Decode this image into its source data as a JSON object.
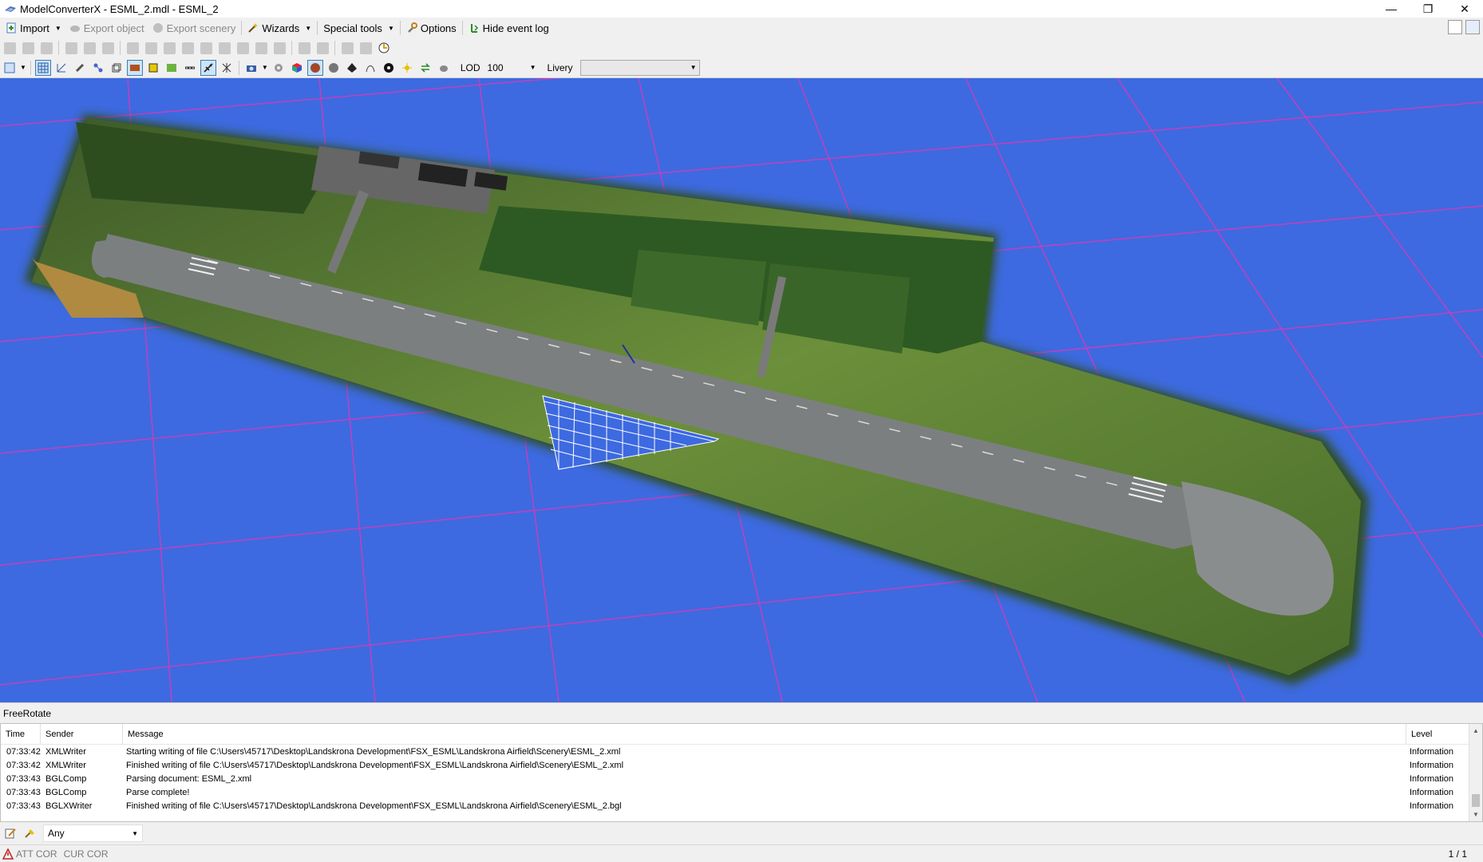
{
  "window": {
    "title": "ModelConverterX - ESML_2.mdl - ESML_2",
    "minimize": "—",
    "restore": "❐",
    "close": "✕"
  },
  "menu": {
    "import": "Import",
    "export_object": "Export object",
    "export_scenery": "Export scenery",
    "wizards": "Wizards",
    "special_tools": "Special tools",
    "options": "Options",
    "hide_event_log": "Hide event log"
  },
  "toolbar": {
    "lod_label": "LOD",
    "lod_value": "100",
    "livery_label": "Livery",
    "livery_value": ""
  },
  "viewport": {
    "background": "#3d6ae0",
    "grid_color": "#c040c0"
  },
  "mode": {
    "label": "FreeRotate"
  },
  "log": {
    "columns": {
      "time": "Time",
      "sender": "Sender",
      "message": "Message",
      "level": "Level"
    },
    "rows": [
      {
        "time": "07:33:42",
        "sender": "XMLWriter",
        "message": "Starting writing of file C:\\Users\\45717\\Desktop\\Landskrona Development\\FSX_ESML\\Landskrona Airfield\\Scenery\\ESML_2.xml",
        "level": "Information"
      },
      {
        "time": "07:33:42",
        "sender": "XMLWriter",
        "message": "Finished writing of file C:\\Users\\45717\\Desktop\\Landskrona Development\\FSX_ESML\\Landskrona Airfield\\Scenery\\ESML_2.xml",
        "level": "Information"
      },
      {
        "time": "07:33:43",
        "sender": "BGLComp",
        "message": "Parsing document: ESML_2.xml",
        "level": "Information"
      },
      {
        "time": "07:33:43",
        "sender": "BGLComp",
        "message": "Parse complete!",
        "level": "Information"
      },
      {
        "time": "07:33:43",
        "sender": "BGLXWriter",
        "message": "Finished writing of file C:\\Users\\45717\\Desktop\\Landskrona Development\\FSX_ESML\\Landskrona Airfield\\Scenery\\ESML_2.bgl",
        "level": "Information"
      }
    ]
  },
  "filter": {
    "value": "Any"
  },
  "status": {
    "att_cor": "ATT COR",
    "cur_cor": "CUR COR",
    "page": "1 / 1"
  }
}
